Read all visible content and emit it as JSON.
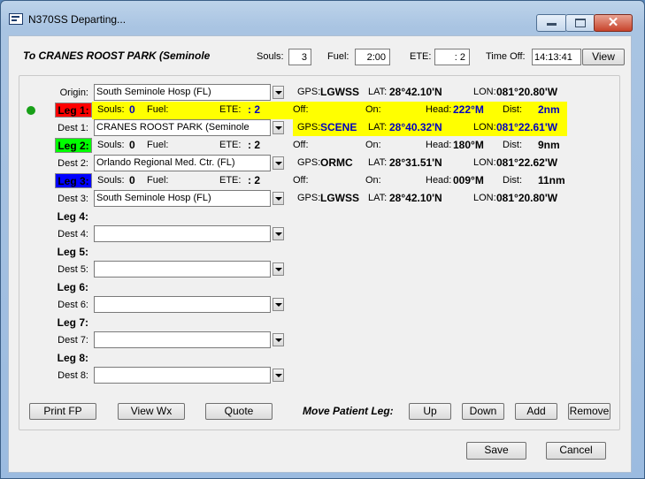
{
  "window": {
    "title": "N370SS Departing..."
  },
  "header": {
    "destination": "To CRANES ROOST PARK (Seminole",
    "souls_label": "Souls:",
    "souls_value": "3",
    "fuel_label": "Fuel:",
    "fuel_value": "2:00",
    "ete_label": "ETE:",
    "ete_value": ": 2",
    "time_off_label": "Time Off:",
    "time_off_value": "14:13:41",
    "view_button": "View"
  },
  "origin": {
    "label": "Origin:",
    "value": "South Seminole Hosp (FL)",
    "gps_label": "GPS:",
    "gps": "LGWSS",
    "lat_label": "LAT:",
    "lat": "28°42.10'N",
    "lon_label": "LON:",
    "lon": "081°20.80'W"
  },
  "legs": [
    {
      "label": "Leg 1:",
      "color": "#ff0000",
      "souls_label": "Souls:",
      "souls": "0",
      "fuel_label": "Fuel:",
      "ete_label": "ETE:",
      "ete": ": 2",
      "off_label": "Off:",
      "on_label": "On:",
      "head_label": "Head:",
      "head": "222°M",
      "dist_label": "Dist:",
      "dist": "2nm"
    },
    {
      "label": "Leg 2:",
      "color": "#00ff00",
      "souls_label": "Souls:",
      "souls": "0",
      "fuel_label": "Fuel:",
      "ete_label": "ETE:",
      "ete": ": 2",
      "off_label": "Off:",
      "on_label": "On:",
      "head_label": "Head:",
      "head": "180°M",
      "dist_label": "Dist:",
      "dist": "9nm"
    },
    {
      "label": "Leg 3:",
      "color": "#0000ff",
      "souls_label": "Souls:",
      "souls": "0",
      "fuel_label": "Fuel:",
      "ete_label": "ETE:",
      "ete": ": 2",
      "off_label": "Off:",
      "on_label": "On:",
      "head_label": "Head:",
      "head": "009°M",
      "dist_label": "Dist:",
      "dist": "11nm"
    }
  ],
  "dests": [
    {
      "label": "Dest 1:",
      "value": "CRANES ROOST PARK (Seminole",
      "gps_label": "GPS:",
      "gps": "SCENE",
      "lat_label": "LAT:",
      "lat": "28°40.32'N",
      "lon_label": "LON:",
      "lon": "081°22.61'W"
    },
    {
      "label": "Dest 2:",
      "value": "Orlando Regional Med. Ctr. (FL)",
      "gps_label": "GPS:",
      "gps": "ORMC",
      "lat_label": "LAT:",
      "lat": "28°31.51'N",
      "lon_label": "LON:",
      "lon": "081°22.62'W"
    },
    {
      "label": "Dest 3:",
      "value": "South Seminole Hosp (FL)",
      "gps_label": "GPS:",
      "gps": "LGWSS",
      "lat_label": "LAT:",
      "lat": "28°42.10'N",
      "lon_label": "LON:",
      "lon": "081°20.80'W"
    }
  ],
  "empty_legs": [
    {
      "leg": "Leg 4:",
      "dest": "Dest 4:"
    },
    {
      "leg": "Leg 5:",
      "dest": "Dest 5:"
    },
    {
      "leg": "Leg 6:",
      "dest": "Dest 6:"
    },
    {
      "leg": "Leg 7:",
      "dest": "Dest 7:"
    },
    {
      "leg": "Leg 8:",
      "dest": "Dest 8:"
    }
  ],
  "bottom": {
    "print_fp": "Print FP",
    "view_wx": "View Wx",
    "quote": "Quote",
    "move_label": "Move Patient Leg:",
    "up": "Up",
    "down": "Down",
    "add": "Add",
    "remove": "Remove",
    "save": "Save",
    "cancel": "Cancel"
  }
}
